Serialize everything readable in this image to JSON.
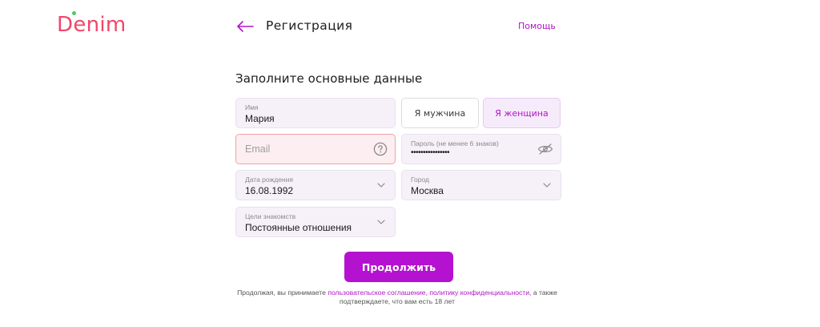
{
  "brand": {
    "logo_text": "Denim",
    "color": "#f2456b",
    "dot_color": "#4fc86b"
  },
  "header": {
    "back_icon": "arrow-left-icon",
    "title": "Регистрация",
    "help_label": "Помощь"
  },
  "form": {
    "subtitle": "Заполните основные данные",
    "name": {
      "label": "Имя",
      "value": "Мария"
    },
    "gender": {
      "male_label": "Я мужчина",
      "female_label": "Я женщина",
      "selected": "female"
    },
    "email": {
      "placeholder": "Email",
      "help_icon": "question-circle-icon",
      "state": "error"
    },
    "password": {
      "label": "Пароль (не менее 6 знаков)",
      "value_masked": "••••••••••••••••",
      "toggle_icon": "eye-off-icon"
    },
    "birthdate": {
      "label": "Дата рождения",
      "value": "16.08.1992"
    },
    "city": {
      "label": "Город",
      "value": "Москва"
    },
    "goal": {
      "label": "Цели знакомств",
      "value": "Постоянные отношения"
    },
    "submit_label": "Продолжить"
  },
  "terms": {
    "prefix": "Продолжая, вы принимаете ",
    "link1": "пользовательское соглашение",
    "sep": ", ",
    "link2": "политику конфиденциальности",
    "suffix": ", а также подтверждаете, что вам есть 18 лет"
  },
  "colors": {
    "accent": "#b412d0",
    "field_bg": "#f6f0f9",
    "error_border": "#f1a0a8"
  }
}
